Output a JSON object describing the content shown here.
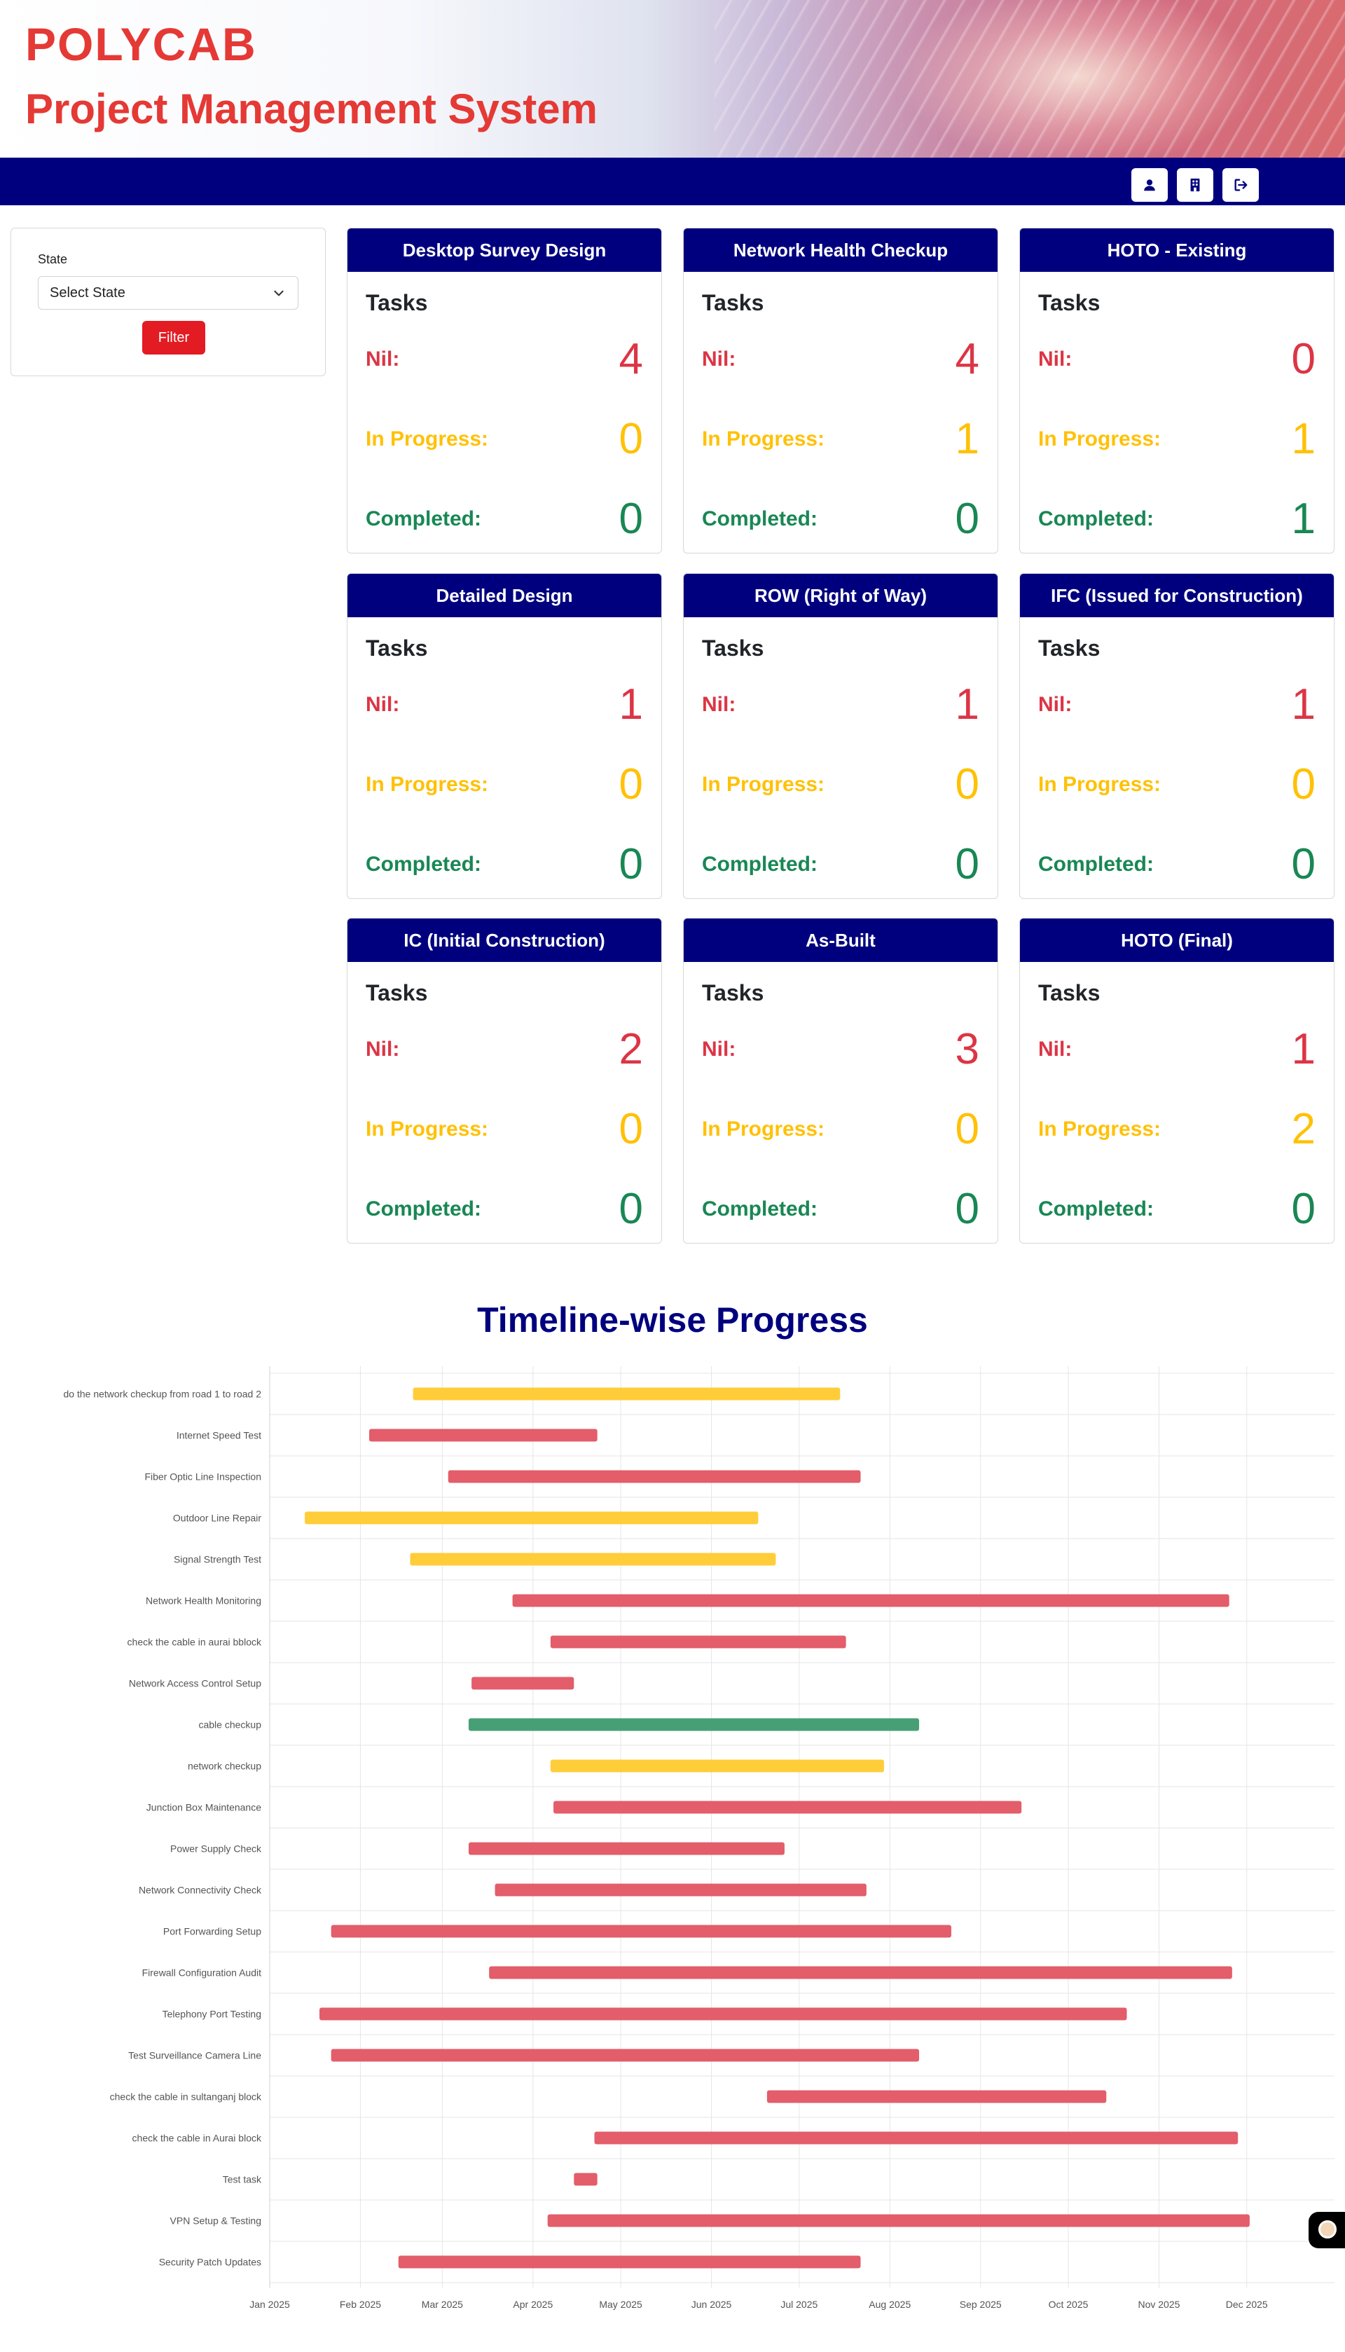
{
  "header": {
    "logo": "POLYCAB",
    "title": "Project Management System"
  },
  "nav": {
    "buttons": [
      {
        "name": "profile",
        "icon": "user-icon"
      },
      {
        "name": "company",
        "icon": "building-icon"
      },
      {
        "name": "logout",
        "icon": "logout-icon"
      }
    ]
  },
  "filter": {
    "label": "State",
    "select_value": "Select State",
    "button": "Filter"
  },
  "labels": {
    "tasks": "Tasks",
    "nil": "Nil:",
    "in_progress": "In Progress:",
    "completed": "Completed:"
  },
  "colors": {
    "navy": "#00007f",
    "nil": "#dc3545",
    "in_progress": "#ffc107",
    "completed": "#198754",
    "bar_nil": "#e35d6a",
    "bar_progress": "#ffcd39",
    "bar_done": "#479f76"
  },
  "cards": [
    {
      "title": "Desktop Survey Design",
      "nil": "4",
      "in_progress": "0",
      "completed": "0"
    },
    {
      "title": "Network Health Checkup",
      "nil": "4",
      "in_progress": "1",
      "completed": "0"
    },
    {
      "title": "HOTO - Existing",
      "nil": "0",
      "in_progress": "1",
      "completed": "1"
    },
    {
      "title": "Detailed Design",
      "nil": "1",
      "in_progress": "0",
      "completed": "0"
    },
    {
      "title": "ROW (Right of Way)",
      "nil": "1",
      "in_progress": "0",
      "completed": "0"
    },
    {
      "title": "IFC (Issued for Construction)",
      "nil": "1",
      "in_progress": "0",
      "completed": "0"
    },
    {
      "title": "IC (Initial Construction)",
      "nil": "2",
      "in_progress": "0",
      "completed": "0"
    },
    {
      "title": "As-Built",
      "nil": "3",
      "in_progress": "0",
      "completed": "0"
    },
    {
      "title": "HOTO (Final)",
      "nil": "1",
      "in_progress": "2",
      "completed": "0"
    }
  ],
  "timeline": {
    "title": "Timeline-wise Progress",
    "chart_data": {
      "type": "bar",
      "orientation": "horizontal-range",
      "x_ticks": [
        "Jan 2025",
        "Feb 2025",
        "Mar 2025",
        "Apr 2025",
        "May 2025",
        "Jun 2025",
        "Jul 2025",
        "Aug 2025",
        "Sep 2025",
        "Oct 2025",
        "Nov 2025",
        "Dec 2025"
      ],
      "xlim": [
        "2025-01-01",
        "2025-12-31"
      ],
      "grid": true,
      "tasks": [
        {
          "name": "do the network checkup from road 1 to road 2",
          "start": "2025-02-19",
          "end": "2025-07-15",
          "status": "in_progress"
        },
        {
          "name": "Internet Speed Test",
          "start": "2025-02-04",
          "end": "2025-04-23",
          "status": "nil"
        },
        {
          "name": "Fiber Optic Line Inspection",
          "start": "2025-03-03",
          "end": "2025-07-22",
          "status": "nil"
        },
        {
          "name": "Outdoor Line Repair",
          "start": "2025-01-13",
          "end": "2025-06-17",
          "status": "in_progress"
        },
        {
          "name": "Signal Strength Test",
          "start": "2025-02-18",
          "end": "2025-06-23",
          "status": "in_progress"
        },
        {
          "name": "Network Health Monitoring",
          "start": "2025-03-25",
          "end": "2025-11-25",
          "status": "nil"
        },
        {
          "name": "check the cable in aurai bblock",
          "start": "2025-04-07",
          "end": "2025-07-17",
          "status": "nil"
        },
        {
          "name": "Network Access Control Setup",
          "start": "2025-03-11",
          "end": "2025-04-15",
          "status": "nil"
        },
        {
          "name": "cable checkup",
          "start": "2025-03-10",
          "end": "2025-08-11",
          "status": "completed"
        },
        {
          "name": "network checkup",
          "start": "2025-04-07",
          "end": "2025-07-30",
          "status": "in_progress"
        },
        {
          "name": "Junction Box Maintenance",
          "start": "2025-04-08",
          "end": "2025-09-15",
          "status": "nil"
        },
        {
          "name": "Power Supply Check",
          "start": "2025-03-10",
          "end": "2025-06-26",
          "status": "nil"
        },
        {
          "name": "Network Connectivity Check",
          "start": "2025-03-19",
          "end": "2025-07-24",
          "status": "nil"
        },
        {
          "name": "Port Forwarding Setup",
          "start": "2025-01-22",
          "end": "2025-08-22",
          "status": "nil"
        },
        {
          "name": "Firewall Configuration Audit",
          "start": "2025-03-17",
          "end": "2025-11-26",
          "status": "nil"
        },
        {
          "name": "Telephony Port Testing",
          "start": "2025-01-18",
          "end": "2025-10-21",
          "status": "nil"
        },
        {
          "name": "Test Surveillance Camera Line",
          "start": "2025-01-22",
          "end": "2025-08-11",
          "status": "nil"
        },
        {
          "name": "check the cable in sultanganj block",
          "start": "2025-06-20",
          "end": "2025-10-14",
          "status": "nil"
        },
        {
          "name": "check the cable in Aurai block",
          "start": "2025-04-22",
          "end": "2025-11-28",
          "status": "nil"
        },
        {
          "name": "Test task",
          "start": "2025-04-15",
          "end": "2025-04-23",
          "status": "nil"
        },
        {
          "name": "VPN Setup & Testing",
          "start": "2025-04-06",
          "end": "2025-12-02",
          "status": "nil"
        },
        {
          "name": "Security Patch Updates",
          "start": "2025-02-14",
          "end": "2025-07-22",
          "status": "nil"
        }
      ]
    }
  }
}
